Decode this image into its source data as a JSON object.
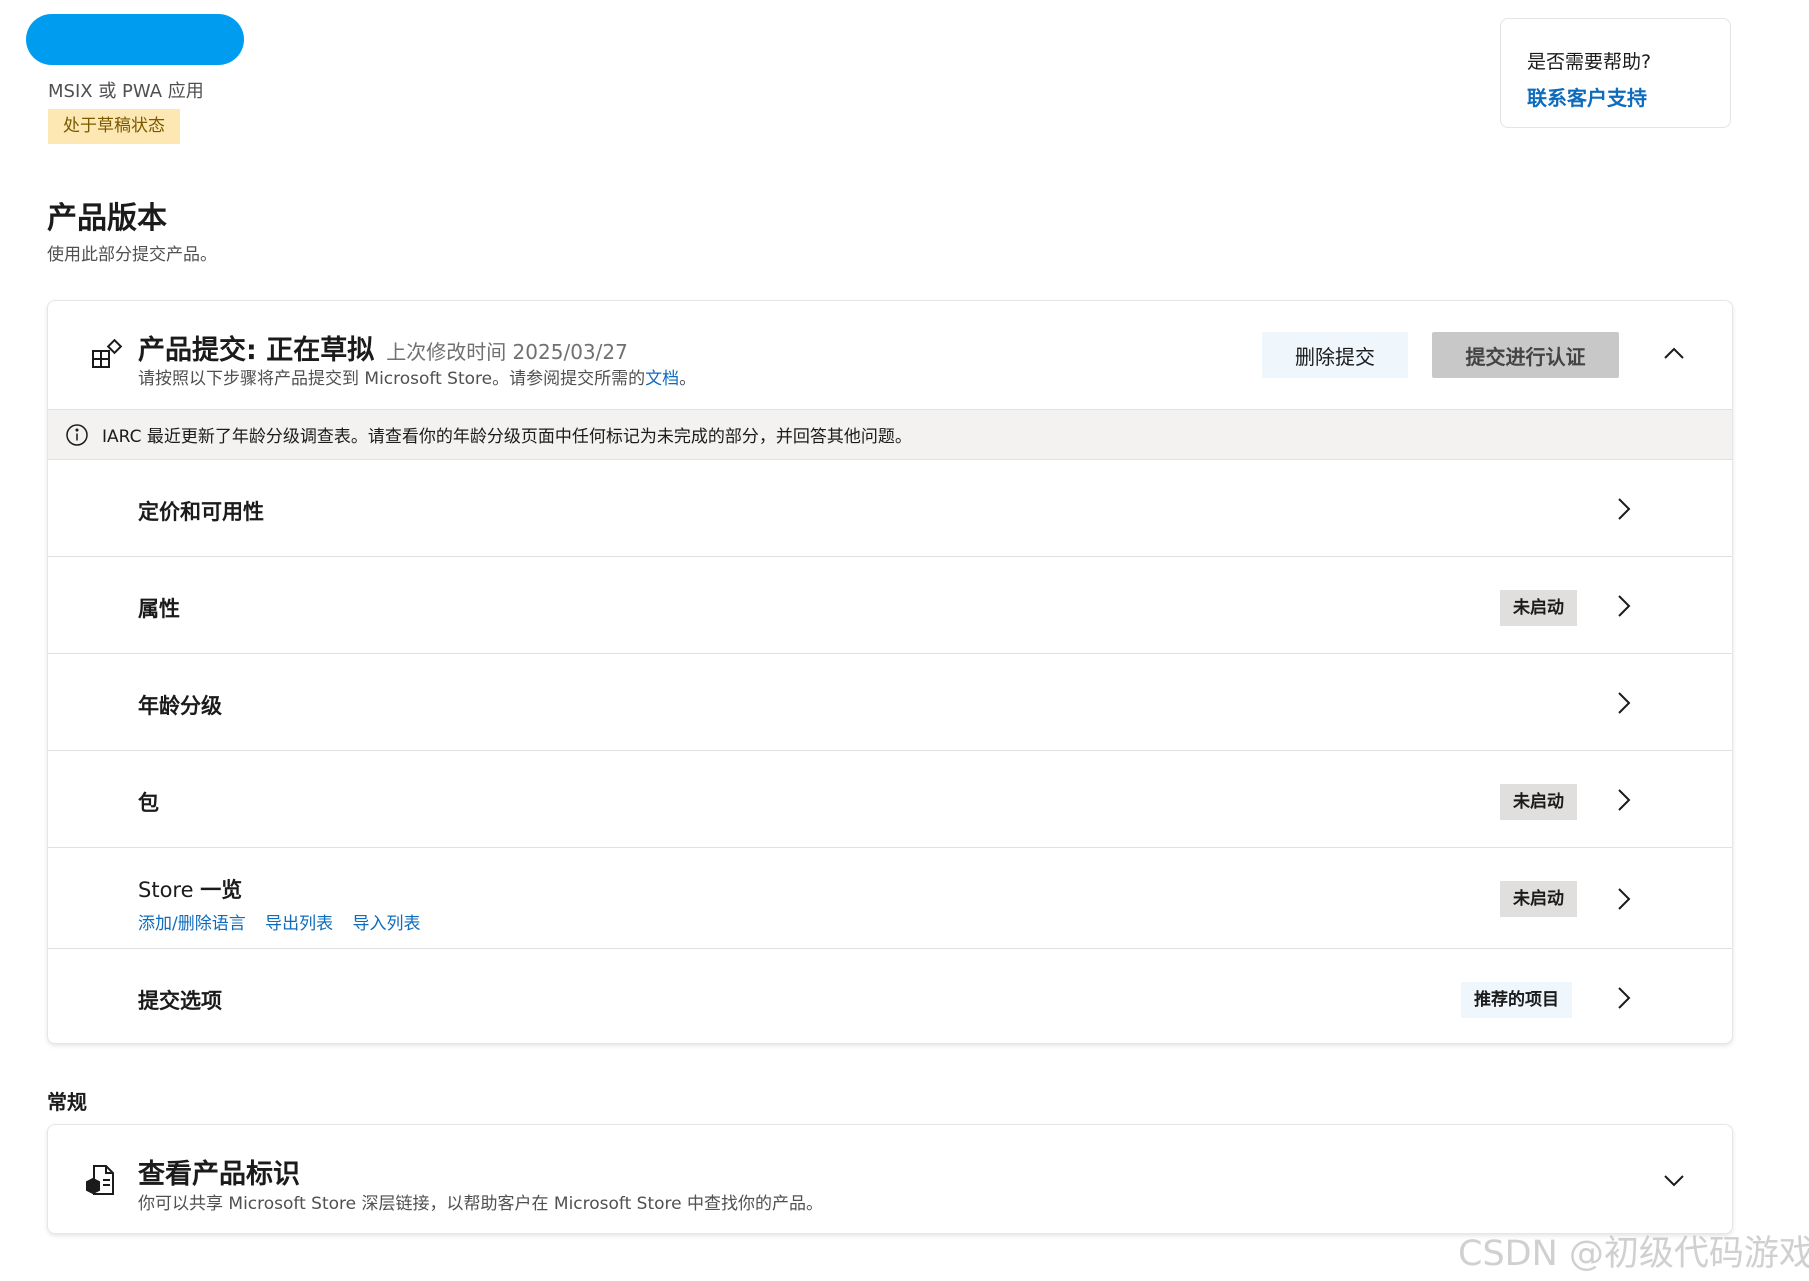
{
  "app": {
    "type_label": "MSIX 或 PWA 应用",
    "status_badge": "处于草稿状态"
  },
  "help": {
    "question": "是否需要帮助?",
    "link": "联系客户支持"
  },
  "section": {
    "title": "产品版本",
    "description": "使用此部分提交产品。"
  },
  "submission": {
    "title": "产品提交: 正在草拟",
    "last_modified": "上次修改时间 2025/03/27",
    "subtitle_text": "请按照以下步骤将产品提交到 Microsoft Store。请参阅提交所需的",
    "doc_link": "文档",
    "subtitle_end": "。",
    "delete_button": "删除提交",
    "submit_button": "提交进行认证",
    "notice": "IARC 最近更新了年龄分级调查表。请查看你的年龄分级页面中任何标记为未完成的部分，并回答其他问题。",
    "rows": [
      {
        "label": "定价和可用性",
        "badge": ""
      },
      {
        "label": "属性",
        "badge": "未启动"
      },
      {
        "label": "年龄分级",
        "badge": ""
      },
      {
        "label": "包",
        "badge": "未启动"
      },
      {
        "label_prefix": "Store ",
        "label_bold": "一览",
        "badge": "未启动",
        "links": [
          "添加/删除语言",
          "导出列表",
          "导入列表"
        ]
      },
      {
        "label": "提交选项",
        "badge": "推荐的项目"
      }
    ]
  },
  "general": {
    "title": "常规",
    "product_id": {
      "title": "查看产品标识",
      "subtitle": "你可以共享 Microsoft Store 深层链接，以帮助客户在 Microsoft Store 中查找你的产品。"
    }
  },
  "watermark": "CSDN @初级代码游戏",
  "colors": {
    "accent": "#0f6cbd",
    "redaction": "#009cf0",
    "draft_badge_bg": "#fde7b3",
    "status_badge_bg": "#e1dfdd",
    "recommended_badge_bg": "#eff6fc",
    "notice_bg": "#f3f2f1"
  },
  "icons": {
    "submission": "apps-add-icon",
    "notice": "info-icon",
    "collapse": "chevron-up-icon",
    "row": "chevron-right-icon",
    "product_id": "box-document-icon",
    "expand": "chevron-down-icon"
  }
}
